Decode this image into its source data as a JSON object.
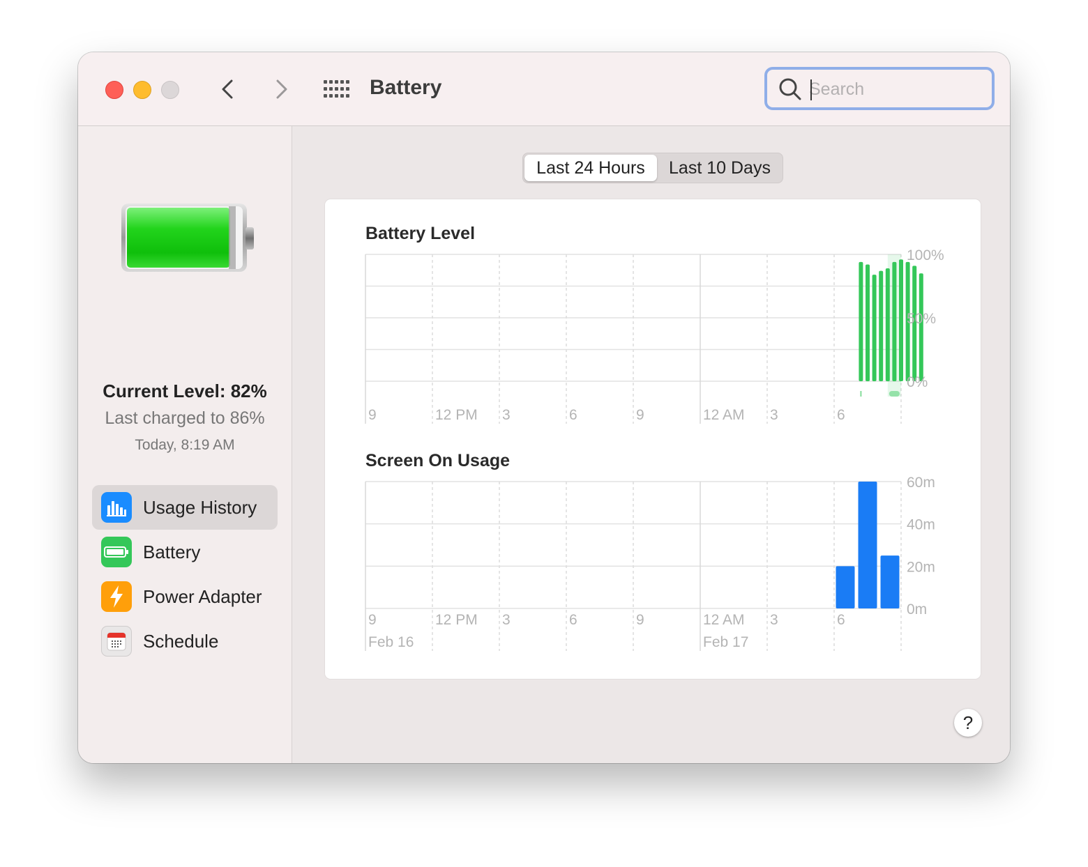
{
  "window": {
    "title": "Battery",
    "search": {
      "placeholder": "Search",
      "value": ""
    }
  },
  "sidebar": {
    "current_level": "Current Level: 82%",
    "last_charged": "Last charged to 86%",
    "charged_time": "Today, 8:19 AM",
    "battery_level_fraction": 0.82,
    "items": [
      {
        "label": "Usage History",
        "icon": "bar-chart-icon",
        "selected": true,
        "color": "#1a8cff"
      },
      {
        "label": "Battery",
        "icon": "battery-icon",
        "selected": false,
        "color": "#34c759"
      },
      {
        "label": "Power Adapter",
        "icon": "lightning-icon",
        "selected": false,
        "color": "#ff9f0a"
      },
      {
        "label": "Schedule",
        "icon": "calendar-icon",
        "selected": false,
        "color": "#e8e8e8"
      }
    ]
  },
  "segmented": {
    "options": [
      "Last 24 Hours",
      "Last 10 Days"
    ],
    "selected": "Last 24 Hours"
  },
  "help_label": "?",
  "chart_data": [
    {
      "type": "bar",
      "title": "Battery Level",
      "x_tick_labels": [
        "9",
        "12 PM",
        "3",
        "6",
        "9",
        "12 AM",
        "3",
        "6"
      ],
      "y_tick_labels": [
        "100%",
        "50%",
        "0%"
      ],
      "ylim": [
        0,
        100
      ],
      "grid": true,
      "color": "#34c759",
      "x_range_hours": [
        0,
        24
      ],
      "x": [
        22.2,
        22.5,
        22.8,
        23.1,
        23.4,
        23.7,
        24.0,
        24.3,
        24.6,
        24.9
      ],
      "values": [
        94,
        92,
        84,
        87,
        89,
        94,
        96,
        94,
        91,
        85
      ],
      "charging_window_hours": [
        23.4,
        24.0
      ],
      "x_tick_hours": [
        0,
        3,
        6,
        9,
        12,
        15,
        18,
        21
      ]
    },
    {
      "type": "bar",
      "title": "Screen On Usage",
      "x_tick_labels": [
        "9",
        "12 PM",
        "3",
        "6",
        "9",
        "12 AM",
        "3",
        "6"
      ],
      "date_labels": [
        {
          "label": "Feb 16",
          "hour": 0
        },
        {
          "label": "Feb 17",
          "hour": 15
        }
      ],
      "y_tick_labels": [
        "60m",
        "40m",
        "20m",
        "0m"
      ],
      "ylim": [
        0,
        60
      ],
      "grid": true,
      "color": "#1a7cf5",
      "x_range_hours": [
        0,
        24
      ],
      "x": [
        21.5,
        22.5,
        23.5
      ],
      "values": [
        20,
        60,
        25
      ],
      "x_tick_hours": [
        0,
        3,
        6,
        9,
        12,
        15,
        18,
        21
      ]
    }
  ]
}
